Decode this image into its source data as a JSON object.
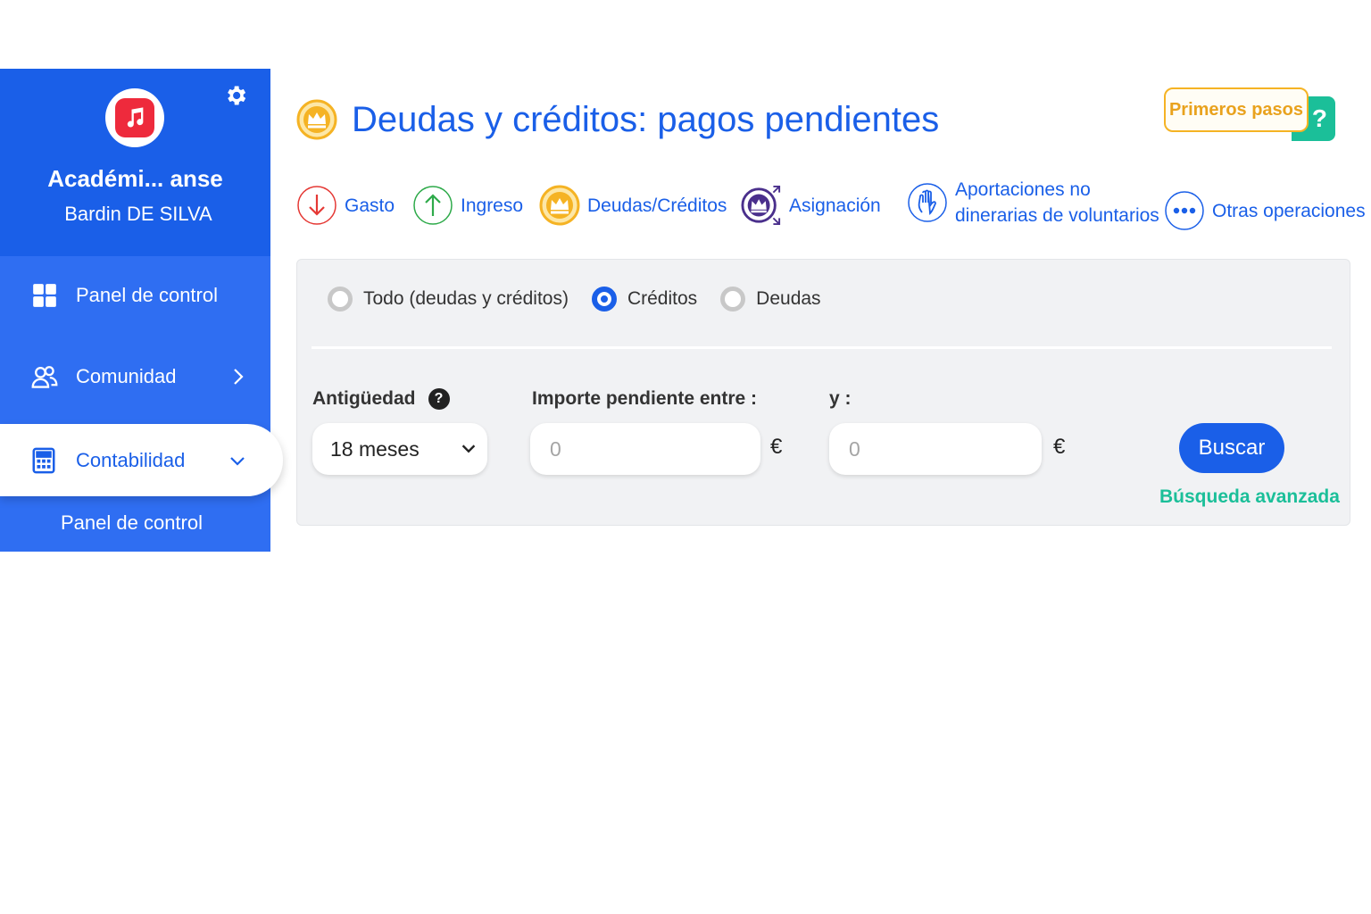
{
  "sidebar": {
    "org_name": "Académi... anse",
    "user_name": "Bardin DE SILVA",
    "items": [
      {
        "label": "Panel de control",
        "icon": "dashboard-grid-icon"
      },
      {
        "label": "Comunidad",
        "icon": "users-icon"
      },
      {
        "label": "Contabilidad",
        "icon": "calculator-icon",
        "active": true
      }
    ],
    "sub_item": "Panel de control",
    "logo_icon": "music-note-icon",
    "settings_icon": "gear-icon"
  },
  "header": {
    "title": "Deudas y créditos: pagos pendientes",
    "primeros_label": "Primeros pasos",
    "help_label": "?"
  },
  "operations": [
    {
      "label": "Gasto",
      "icon": "arrow-down-icon",
      "color": "#e53935"
    },
    {
      "label": "Ingreso",
      "icon": "arrow-up-icon",
      "color": "#2eaa4a"
    },
    {
      "label": "Deudas/Créditos",
      "icon": "crown-coin-icon",
      "color": "#f5b324"
    },
    {
      "label": "Asignación",
      "icon": "crown-transfer-icon",
      "color": "#4a2f8c"
    },
    {
      "label_line1": "Aportaciones no",
      "label_line2": "dinerarias de voluntarios",
      "icon": "hand-icon",
      "color": "#1a5fe8"
    },
    {
      "label": "Otras operaciones",
      "icon": "more-dots-icon",
      "color": "#1a5fe8"
    }
  ],
  "filters": {
    "radios": [
      {
        "label": "Todo (deudas y créditos)",
        "selected": false
      },
      {
        "label": "Créditos",
        "selected": true
      },
      {
        "label": "Deudas",
        "selected": false
      }
    ],
    "antiguedad_label": "Antigüedad",
    "antiguedad_value": "18 meses",
    "importe_label": "Importe pendiente entre :",
    "importe_min_placeholder": "0",
    "y_label": "y :",
    "importe_max_placeholder": "0",
    "currency": "€",
    "search_label": "Buscar",
    "advanced_label": "Búsqueda avanzada"
  },
  "colors": {
    "brand_blue": "#1a5fe8",
    "sidebar_blue": "#2f6ef2",
    "accent_green": "#1bbf99",
    "accent_yellow": "#f5b324"
  }
}
